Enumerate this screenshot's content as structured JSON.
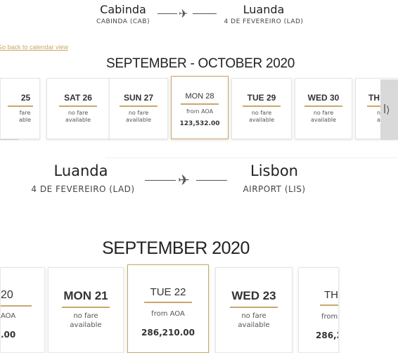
{
  "leg1": {
    "origin_city": "Cabinda",
    "origin_code": "CABINDA (CAB)",
    "dest_city": "Luanda",
    "dest_code": "4 DE FEVEREIRO (LAD)",
    "plane_icon": "airplane-icon",
    "back_link": "Go back to calendar view",
    "month_title": "SEPTEMBER - OCTOBER 2020",
    "days": [
      {
        "label": "25",
        "line1": "fare",
        "line2": "able"
      },
      {
        "label": "SAT 26",
        "line1": "no fare",
        "line2": "available"
      },
      {
        "label": "SUN 27",
        "line1": "no fare",
        "line2": "available"
      },
      {
        "label": "MON 28",
        "line1": "from AOA",
        "line2": "123,532.00"
      },
      {
        "label": "TUE 29",
        "line1": "no fare",
        "line2": "available"
      },
      {
        "label": "WED 30",
        "line1": "no fare",
        "line2": "available"
      },
      {
        "label": "TH",
        "line1": "no",
        "line2": "av"
      }
    ],
    "prev_icon": "calendar-prev-icon",
    "next_icon": "calendar-next-icon"
  },
  "leg2": {
    "origin_city": "Luanda",
    "origin_code": "4 DE FEVEREIRO (LAD)",
    "dest_city": "Lisbon",
    "dest_code": "AIRPORT (LIS)",
    "plane_icon": "airplane-icon",
    "month_title": "SEPTEMBER 2020",
    "days": [
      {
        "label": "20",
        "line1": "AOA",
        "line2": ".00"
      },
      {
        "label": "MON 21",
        "line1": "no fare",
        "line2": "available"
      },
      {
        "label": "TUE 22",
        "line1": "from AOA",
        "line2": "286,210.00"
      },
      {
        "label": "WED 23",
        "line1": "no fare",
        "line2": "available"
      },
      {
        "label": "THU",
        "line1": "from",
        "line2": "286,2"
      }
    ]
  }
}
